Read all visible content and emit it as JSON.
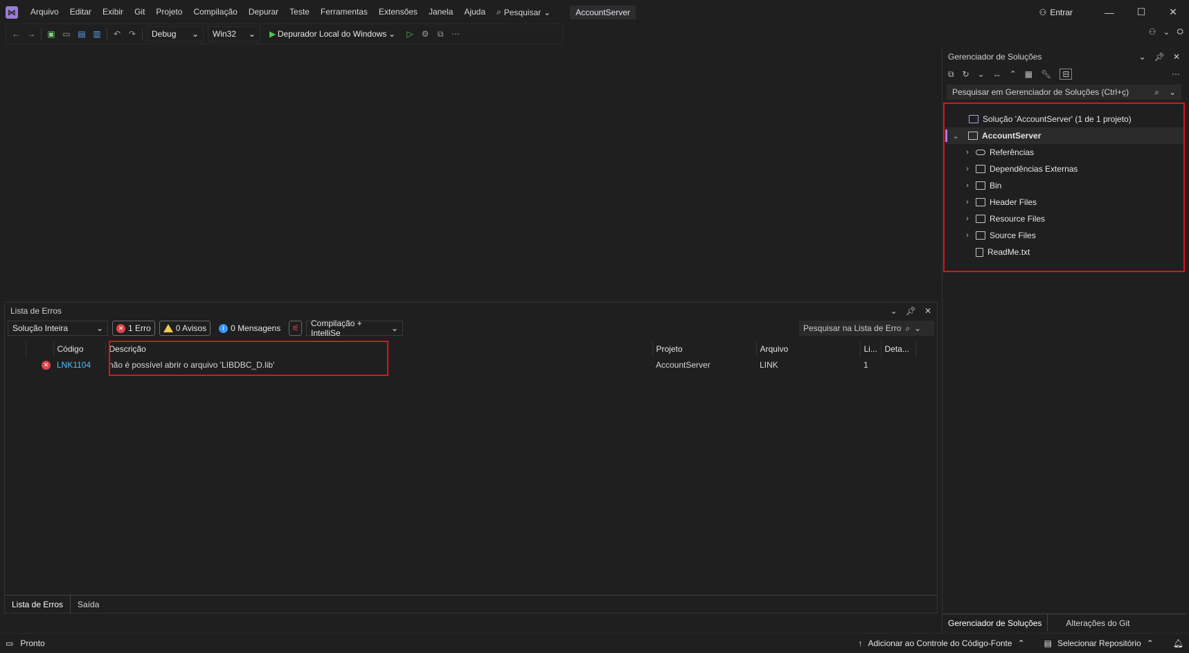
{
  "menu": {
    "items": [
      "Arquivo",
      "Editar",
      "Exibir",
      "Git",
      "Projeto",
      "Compilação",
      "Depurar",
      "Teste",
      "Ferramentas",
      "Extensões",
      "Janela",
      "Ajuda"
    ],
    "search_label": "Pesquisar",
    "project_title": "AccountServer",
    "signin_label": "Entrar"
  },
  "toolbar": {
    "config": "Debug",
    "platform": "Win32",
    "debugger": "Depurador Local do Windows"
  },
  "error_list": {
    "title": "Lista de Erros",
    "scope": "Solução Inteira",
    "errors_chip": "1 Erro",
    "warnings_chip": "0 Avisos",
    "messages_chip": "0 Mensagens",
    "source_filter": "Compilação + IntelliSe",
    "search_placeholder": "Pesquisar na Lista de Erro",
    "columns": {
      "code": "Código",
      "description": "Descrição",
      "project": "Projeto",
      "file": "Arquivo",
      "line": "Li...",
      "details": "Deta..."
    },
    "rows": [
      {
        "code": "LNK1104",
        "description": "não é possível abrir o arquivo 'LIBDBC_D.lib'",
        "project": "AccountServer",
        "file": "LINK",
        "line": "1"
      }
    ],
    "tabs": [
      "Lista de Erros",
      "Saída"
    ]
  },
  "solution_explorer": {
    "title": "Gerenciador de Soluções",
    "search_placeholder": "Pesquisar em Gerenciador de Soluções (Ctrl+ç)",
    "solution_label": "Solução 'AccountServer' (1 de 1 projeto)",
    "project_label": "AccountServer",
    "items": [
      "Referências",
      "Dependências Externas",
      "Bin",
      "Header Files",
      "Resource Files",
      "Source Files",
      "ReadMe.txt"
    ],
    "tabs": [
      "Gerenciador de Soluções",
      "Alterações do Git"
    ]
  },
  "status": {
    "left": "Pronto",
    "source_control": "Adicionar ao Controle do Código-Fonte",
    "repo": "Selecionar Repositório"
  },
  "colors": {
    "background": "#1f1f1f",
    "accent": "#a77cf0",
    "error": "#e0434b",
    "warning": "#f2c94c",
    "info": "#3794ff",
    "link": "#4fc1ff",
    "highlight": "#e0121c"
  }
}
